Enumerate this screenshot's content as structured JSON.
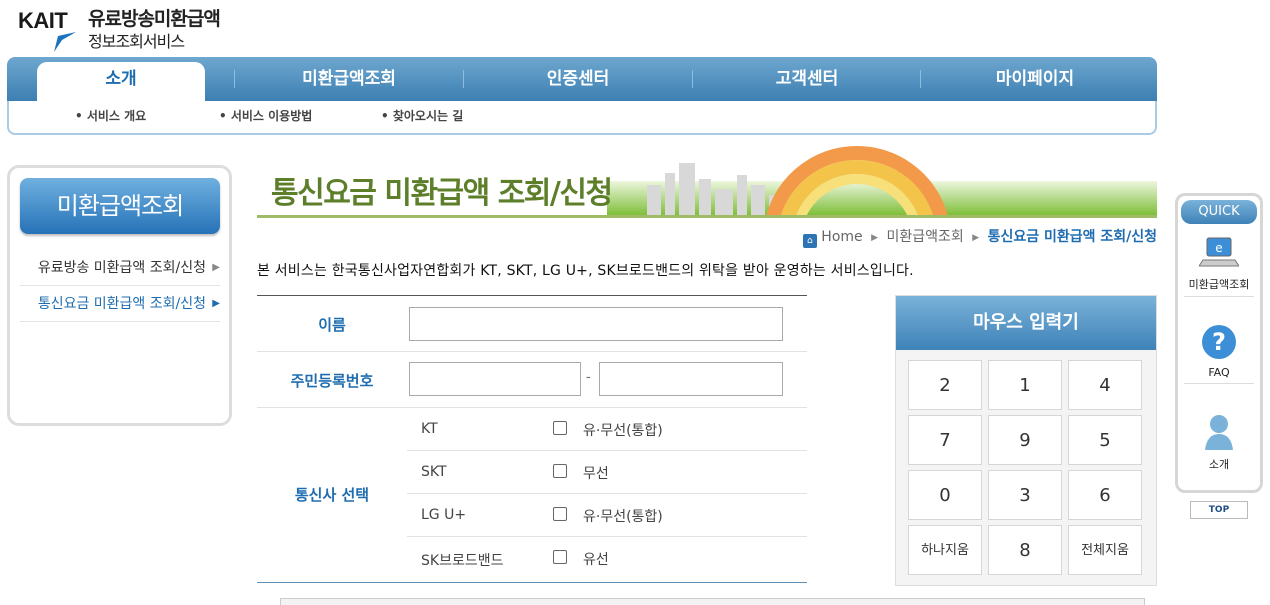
{
  "logo": {
    "brand": "KAIT",
    "line1": "유료방송미환급액",
    "line2": "정보조회서비스"
  },
  "gnb": [
    {
      "label": "소개"
    },
    {
      "label": "미환급액조회"
    },
    {
      "label": "인증센터"
    },
    {
      "label": "고객센터"
    },
    {
      "label": "마이페이지"
    }
  ],
  "subnav": [
    "• 서비스 개요",
    "• 서비스 이용방법",
    "• 찾아오시는 길"
  ],
  "lnb": {
    "title": "미환급액조회",
    "items": [
      {
        "label": "유료방송 미환급액 조회/신청"
      },
      {
        "label": "통신요금 미환급액 조회/신청"
      }
    ]
  },
  "banner": {
    "title": "통신요금 미환급액 조회/신청"
  },
  "breadcrumb": {
    "home": "Home",
    "mid": "미환급액조회",
    "current": "통신요금 미환급액 조회/신청"
  },
  "intro": "본 서비스는 한국통신사업자연합회가 KT, SKT, LG U+, SK브로드밴드의 위탁을 받아 운영하는 서비스입니다.",
  "form": {
    "name_label": "이름",
    "name_value": "",
    "rrn_label": "주민등록번호",
    "rrn_dash": "-",
    "telco_label": "통신사 선택",
    "telcos": [
      {
        "name": "KT",
        "service": "유·무선(통합)"
      },
      {
        "name": "SKT",
        "service": "무선"
      },
      {
        "name": "LG U+",
        "service": "유·무선(통합)"
      },
      {
        "name": "SK브로드밴드",
        "service": "유선"
      }
    ]
  },
  "keypad": {
    "title": "마우스 입력기",
    "keys": [
      "2",
      "1",
      "4",
      "7",
      "9",
      "5",
      "0",
      "3",
      "6",
      "하나지움",
      "8",
      "전체지움"
    ]
  },
  "quick": {
    "title": "QUICK",
    "items": [
      {
        "label": "미환급액조회",
        "icon": "laptop-icon"
      },
      {
        "label": "FAQ",
        "icon": "question-icon"
      },
      {
        "label": "소개",
        "icon": "person-icon"
      }
    ],
    "top": "TOP"
  },
  "colors": {
    "brand_blue": "#1f6db0",
    "nav_blue": "#3c7fb2",
    "banner_green": "#5d7f2a"
  }
}
